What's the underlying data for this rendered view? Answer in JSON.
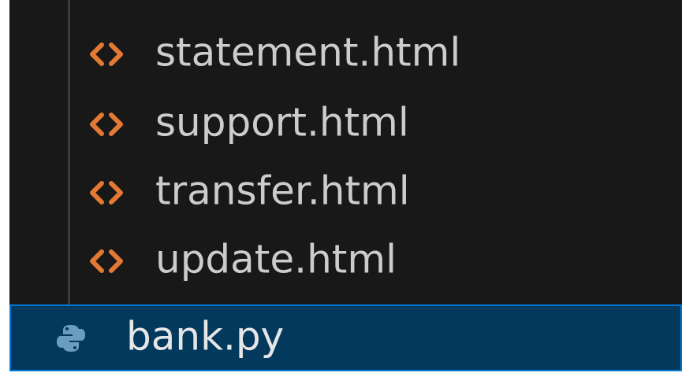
{
  "explorer": {
    "files": [
      {
        "name": "statement.html",
        "icon": "html-file-icon"
      },
      {
        "name": "support.html",
        "icon": "html-file-icon"
      },
      {
        "name": "transfer.html",
        "icon": "html-file-icon"
      },
      {
        "name": "update.html",
        "icon": "html-file-icon"
      }
    ],
    "selected_file": {
      "name": "bank.py",
      "icon": "python-file-icon"
    }
  },
  "colors": {
    "background": "#181818",
    "text": "#cccccc",
    "html_icon": "#e37933",
    "python_icon": "#6a9dbf",
    "selection_background": "#04395e",
    "selection_border": "#0078d4"
  }
}
